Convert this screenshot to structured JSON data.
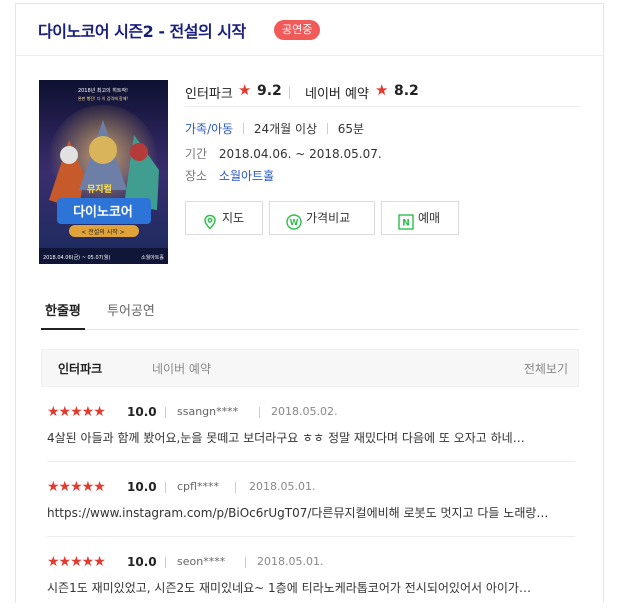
{
  "header": {
    "title": "다이노코어 시즌2 - 전설의 시작",
    "status_badge": "공연중"
  },
  "poster": {
    "top_caption": "2018년 최고의 히트작!",
    "sub_caption": "완판 행진! 다 이 감격에 함께!",
    "title_line1": "뮤지컬",
    "title_logo": "다이노코어",
    "subtitle": "< 전설의 시작 >",
    "dates": "2018.04.06(금) ~ 05.07(월)",
    "venue": "소월아트홀"
  },
  "ratings": {
    "interpark": {
      "source": "인터파크",
      "star": "★",
      "score": "9.2"
    },
    "naver": {
      "source": "네이버 예약",
      "star": "★",
      "score": "8.2"
    }
  },
  "info": {
    "genre": "가족/아동",
    "age": "24개월 이상",
    "runtime": "65분",
    "period_label": "기간",
    "period_value": "2018.04.06. ~ 2018.05.07.",
    "place_label": "장소",
    "place_value": "소월아트홀"
  },
  "buttons": {
    "map": "지도",
    "compare": "가격비교",
    "reserve": "예매",
    "compare_icon_letter": "W",
    "reserve_icon_letter": "N"
  },
  "tabs": [
    "한줄평",
    "투어공연"
  ],
  "subtabs": {
    "interpark": "인터파크",
    "naver": "네이버 예약",
    "view_all": "전체보기"
  },
  "reviews": [
    {
      "stars": "★★★★★",
      "score": "10.0",
      "user": "ssangn****",
      "date": "2018.05.02.",
      "text": "4살된 아들과 함께 봤어요,눈을 못떼고 보더라구요 ㅎㅎ 정말 재밌다며 다음에 또 오자고 하네…"
    },
    {
      "stars": "★★★★★",
      "score": "10.0",
      "user": "cpfl****",
      "date": "2018.05.01.",
      "text": "https://www.instagram.com/p/BiOc6rUgT07/다른뮤지컬에비해 로봇도 멋지고 다들 노래랑…"
    },
    {
      "stars": "★★★★★",
      "score": "10.0",
      "user": "seon****",
      "date": "2018.05.01.",
      "text": "시즌1도 재미있었고, 시즌2도 재미있네요~ 1층에 티라노케라톱코어가 전시되어있어서 아이가…"
    }
  ],
  "colors": {
    "title": "#1a1f7c",
    "badge": "#f25a5a",
    "star": "#e23b2e",
    "link": "#2a58c4",
    "icon_green": "#2dbf4c"
  }
}
